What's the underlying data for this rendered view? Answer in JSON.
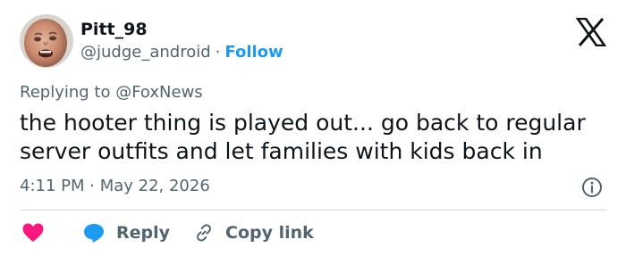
{
  "author": {
    "name": "Pitt_98",
    "handle": "@judge_android",
    "separator": "·",
    "follow_label": "Follow"
  },
  "reply_context": {
    "prefix": "Replying to",
    "mention": "@FoxNews"
  },
  "tweet": {
    "text": "the hooter thing is played out... go back to regular server outfits and let families with kids back in",
    "timestamp": "4:11 PM · May 22, 2026"
  },
  "actions": {
    "reply_label": "Reply",
    "copy_link_label": "Copy link"
  },
  "icons": {
    "brand": "x-logo-icon",
    "info": "info-icon",
    "like": "heart-icon",
    "reply": "chat-bubble-icon",
    "copy": "link-icon"
  },
  "colors": {
    "accent": "#1d9bf0",
    "like": "#f91880",
    "muted_text": "#536471",
    "main_text": "#0f1419",
    "divider": "#cfd9de"
  }
}
